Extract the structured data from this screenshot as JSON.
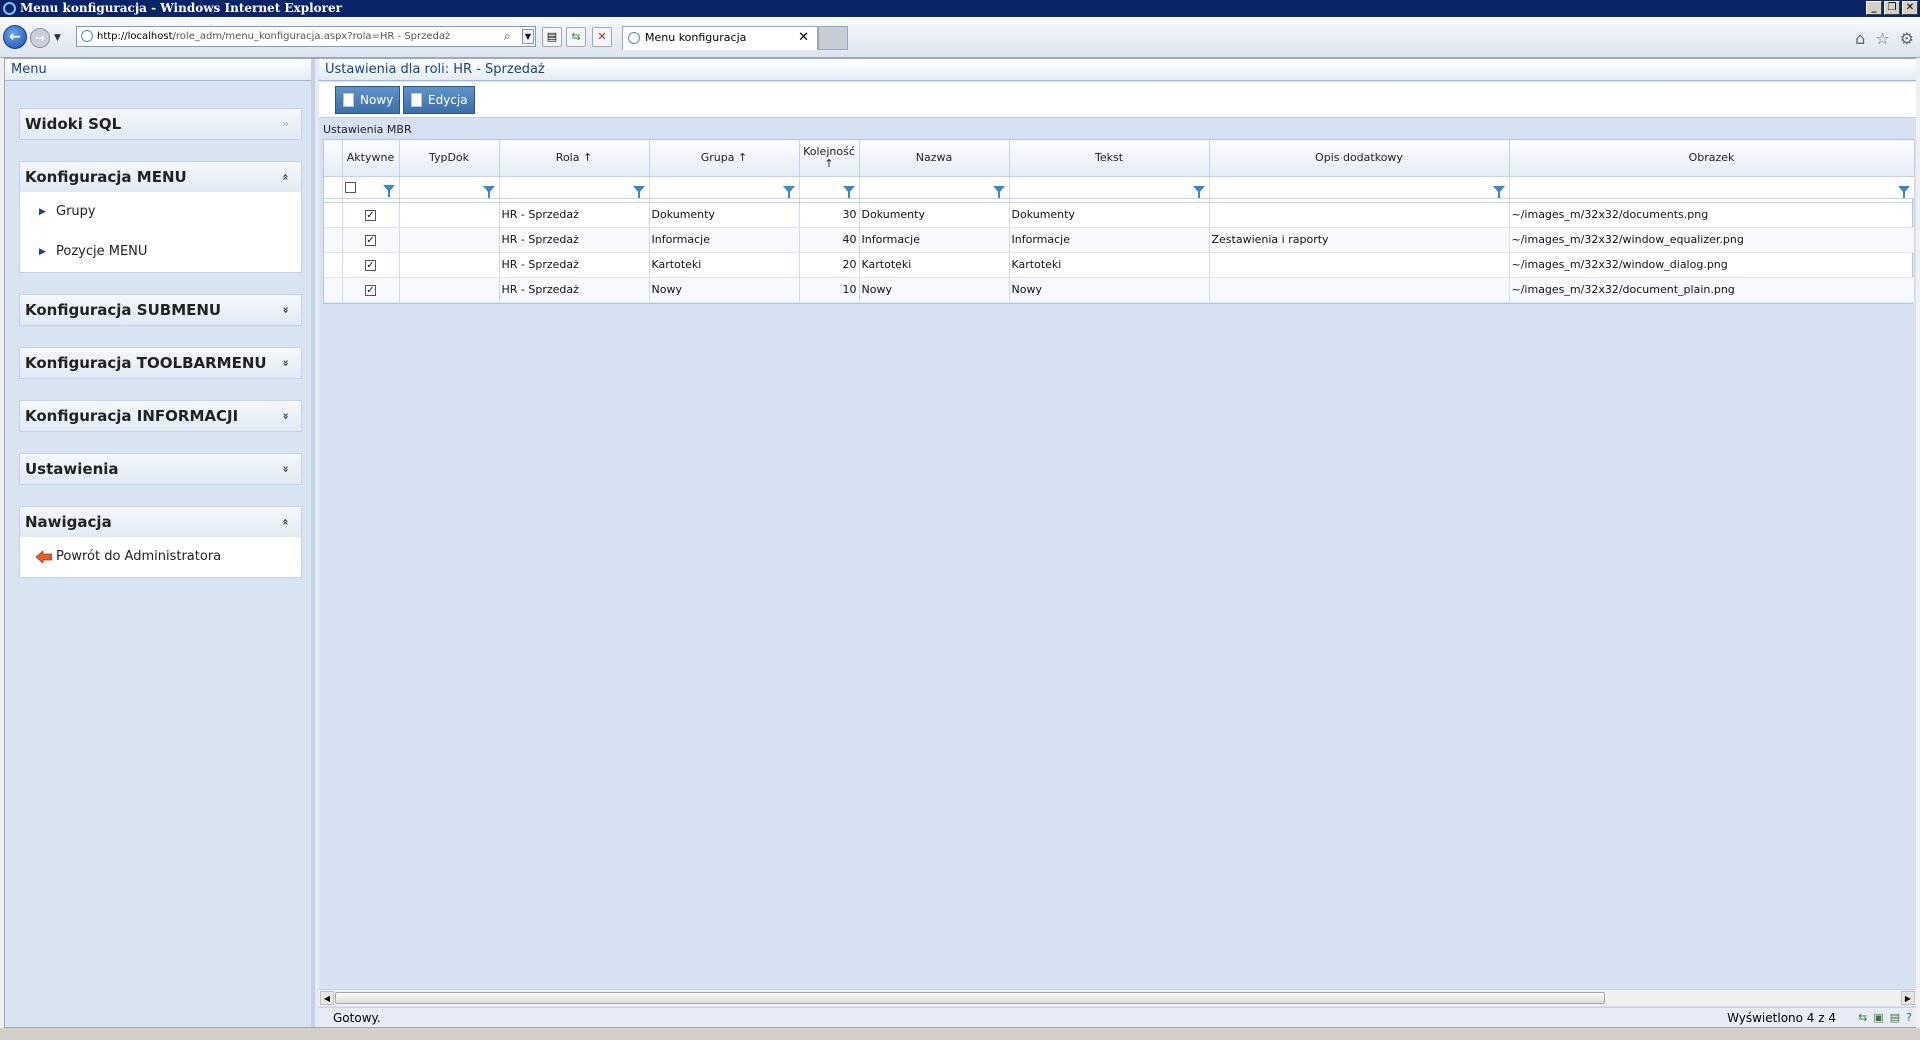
{
  "window": {
    "title": "Menu konfiguracja - Windows Internet Explorer"
  },
  "browser": {
    "address_host": "http://localhost",
    "address_path": "/role_adm/menu_konfiguracja.aspx?rola=HR - Sprzedaż",
    "tab_title": "Menu konfiguracja"
  },
  "menu": {
    "header": "Menu",
    "sections": [
      {
        "title": "Widoki SQL",
        "state": "collapsed",
        "items": []
      },
      {
        "title": "Konfiguracja MENU",
        "state": "expanded",
        "items": [
          "Grupy",
          "Pozycje MENU"
        ]
      },
      {
        "title": "Konfiguracja SUBMENU",
        "state": "collapsed",
        "items": []
      },
      {
        "title": "Konfiguracja TOOLBARMENU",
        "state": "collapsed",
        "items": []
      },
      {
        "title": "Konfiguracja INFORMACJI",
        "state": "collapsed",
        "items": []
      },
      {
        "title": "Ustawienia",
        "state": "collapsed",
        "items": []
      },
      {
        "title": "Nawigacja",
        "state": "expanded",
        "items": [
          "Powrót do Administratora"
        ]
      }
    ]
  },
  "main": {
    "header": "Ustawienia dla roli: HR - Sprzedaż",
    "toolbar": {
      "new_label": "Nowy",
      "edit_label": "Edycja"
    },
    "grid_caption": "Ustawienia MBR",
    "columns": [
      "Aktywne",
      "TypDok",
      "Rola ↑",
      "Grupa ↑",
      "Kolejność ↑",
      "Nazwa",
      "Tekst",
      "Opis dodatkowy",
      "Obrazek"
    ],
    "rows": [
      {
        "aktywne": "✓",
        "typdok": "",
        "rola": "HR - Sprzedaż",
        "grupa": "Dokumenty",
        "kolejnosc": "30",
        "nazwa": "Dokumenty",
        "tekst": "Dokumenty",
        "opis": "",
        "obrazek": "~/images_m/32x32/documents.png"
      },
      {
        "aktywne": "✓",
        "typdok": "",
        "rola": "HR - Sprzedaż",
        "grupa": "Informacje",
        "kolejnosc": "40",
        "nazwa": "Informacje",
        "tekst": "Informacje",
        "opis": "Zestawienia i raporty",
        "obrazek": "~/images_m/32x32/window_equalizer.png"
      },
      {
        "aktywne": "✓",
        "typdok": "",
        "rola": "HR - Sprzedaż",
        "grupa": "Kartoteki",
        "kolejnosc": "20",
        "nazwa": "Kartoteki",
        "tekst": "Kartoteki",
        "opis": "",
        "obrazek": "~/images_m/32x32/window_dialog.png"
      },
      {
        "aktywne": "✓",
        "typdok": "",
        "rola": "HR - Sprzedaż",
        "grupa": "Nowy",
        "kolejnosc": "10",
        "nazwa": "Nowy",
        "tekst": "Nowy",
        "opis": "",
        "obrazek": "~/images_m/32x32/document_plain.png"
      }
    ],
    "status_left": "Gotowy.",
    "status_right": "Wyświetlono 4 z 4"
  },
  "colors": {
    "accent": "#15428b",
    "title_bar": "#0a246a",
    "button": "#4a7fb8"
  },
  "icons": [
    "ie-logo-icon",
    "back-arrow-icon",
    "forward-arrow-icon",
    "search-icon",
    "refresh-icon",
    "stop-icon",
    "home-icon",
    "favorites-star-icon",
    "tools-gear-icon",
    "document-icon",
    "edit-icon",
    "filter-icon",
    "chevron-down-icon",
    "chevron-up-icon",
    "triangle-right-icon",
    "back-red-arrow-icon"
  ]
}
